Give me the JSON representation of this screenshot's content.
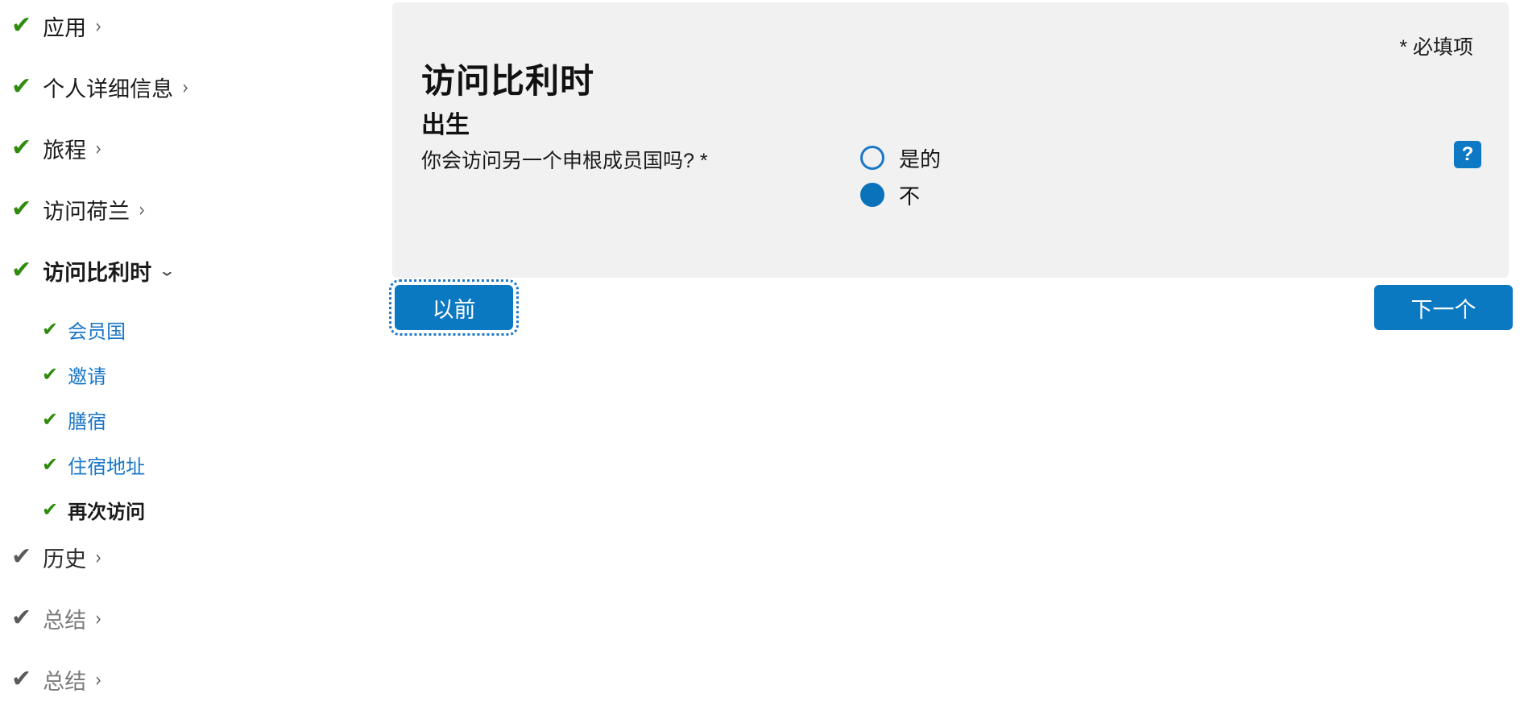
{
  "sidebar": {
    "items": [
      {
        "label": "应用",
        "check": "green",
        "chevron": "right",
        "style": "normal",
        "level": 0
      },
      {
        "label": "个人详细信息",
        "check": "green",
        "chevron": "right",
        "style": "normal",
        "level": 0
      },
      {
        "label": "旅程",
        "check": "green",
        "chevron": "right",
        "style": "normal",
        "level": 0
      },
      {
        "label": "访问荷兰",
        "check": "green",
        "chevron": "right",
        "style": "normal",
        "level": 0
      },
      {
        "label": "访问比利时",
        "check": "green",
        "chevron": "down",
        "style": "bold",
        "level": 0
      },
      {
        "label": "会员国",
        "check": "green",
        "chevron": "none",
        "style": "link",
        "level": 1
      },
      {
        "label": "邀请",
        "check": "green",
        "chevron": "none",
        "style": "link",
        "level": 1
      },
      {
        "label": "膳宿",
        "check": "green",
        "chevron": "none",
        "style": "link",
        "level": 1
      },
      {
        "label": "住宿地址",
        "check": "green",
        "chevron": "none",
        "style": "link",
        "level": 1
      },
      {
        "label": "再次访问",
        "check": "green",
        "chevron": "none",
        "style": "bold",
        "level": 1
      },
      {
        "label": "历史",
        "check": "gray",
        "chevron": "right",
        "style": "dim",
        "level": 0
      },
      {
        "label": "总结",
        "check": "gray",
        "chevron": "right",
        "style": "muted",
        "level": 0
      },
      {
        "label": "总结",
        "check": "gray",
        "chevron": "right",
        "style": "muted",
        "level": 0
      }
    ],
    "chevron_right_glyph": "›",
    "chevron_down_glyph": "⌄",
    "check_glyph": "✔"
  },
  "main": {
    "title": "访问比利时",
    "subtitle": "出生",
    "required_note": "* 必填项",
    "question": {
      "label": "你会访问另一个申根成员国吗? *",
      "options": [
        {
          "label": "是的",
          "selected": false
        },
        {
          "label": "不",
          "selected": true
        }
      ],
      "help_glyph": "?",
      "help_name": "question-mark-icon"
    },
    "buttons": {
      "previous": "以前",
      "next": "下一个"
    }
  },
  "colors": {
    "panel_bg": "#f1f1f1",
    "accent_blue": "#0b78c2",
    "link_blue": "#1b77c8",
    "check_green": "#2e8b0b",
    "check_gray": "#5a5a5a",
    "page_bg": "#ffffff"
  }
}
